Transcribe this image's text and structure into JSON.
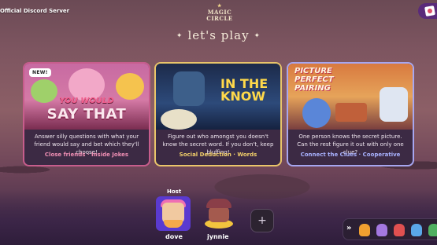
{
  "server": {
    "label": "Official Discord Server"
  },
  "logo": {
    "line1": "MAGIC",
    "line2": "CIRCLE",
    "star": "★"
  },
  "heading": {
    "text": "let's play",
    "spark_left": "✦",
    "spark_right": "✦"
  },
  "cards": [
    {
      "badge": "NEW!",
      "title_line1": "YOU WOULD",
      "title_line2": "SAY THAT",
      "description": "Answer silly questions with what your friend would say and bet which they'll choose!",
      "tags": "Close friends · Inside Jokes",
      "accent": "#c75d8c"
    },
    {
      "title_line1": "IN THE",
      "title_line2": "KNOW",
      "description": "Figure out who amongst you doesn't know the secret word. If you don't, keep bluffing!",
      "tags": "Social Deduction · Words",
      "accent": "#e9c56a"
    },
    {
      "title_line1": "PICTURE",
      "title_line2": "PERFECT",
      "title_line3": "PAIRING",
      "description": "One person knows the secret picture. Can the rest figure it out with only one clue?",
      "tags": "Connect the Clues · Cooperative",
      "accent": "#a6a6f0"
    }
  ],
  "players": {
    "host_label": "Host",
    "list": [
      {
        "name": "dove",
        "icon": "dove-avatar-icon"
      },
      {
        "name": "jynnie",
        "icon": "jynnie-avatar-icon"
      }
    ],
    "add_symbol": "+"
  },
  "tray": {
    "chevron": "»",
    "colors": [
      "#f0a030",
      "#a478e0",
      "#e05050",
      "#5aa8e8",
      "#4fb060"
    ]
  }
}
